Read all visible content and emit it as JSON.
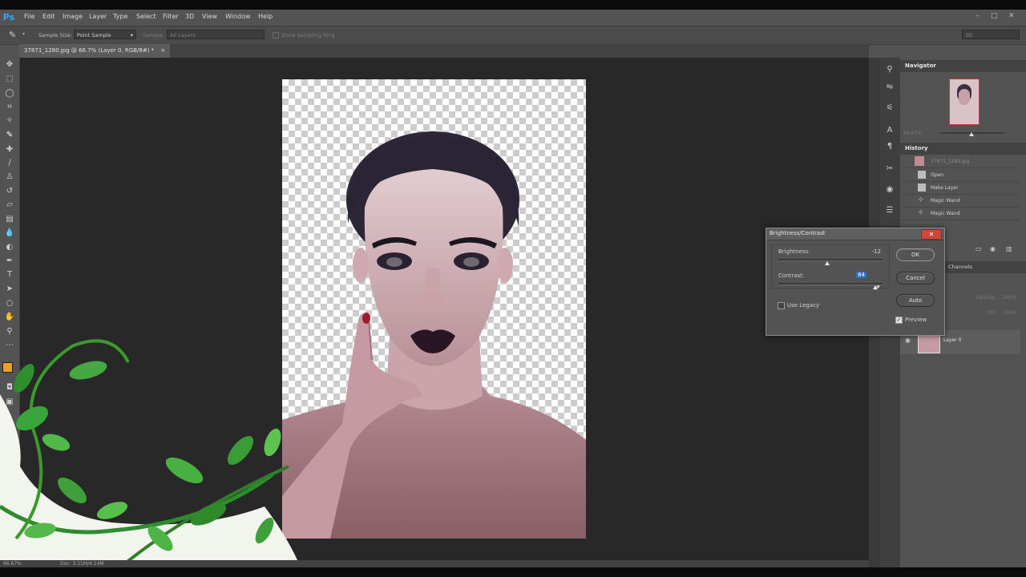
{
  "app": {
    "logo": "Ps",
    "menu": [
      "File",
      "Edit",
      "Image",
      "Layer",
      "Type",
      "Select",
      "Filter",
      "3D",
      "View",
      "Window",
      "Help"
    ],
    "window_controls": [
      "–",
      "□",
      "✕"
    ]
  },
  "options_bar": {
    "sample_size_label": "Sample Size:",
    "sample_size_value": "Point Sample",
    "sample_label": "Sample:",
    "sample_value": "All Layers",
    "show_sampling_ring": "Show Sampling Ring",
    "workspace": "3D"
  },
  "document_tab": {
    "title": "37871_1280.jpg @ 66.7% (Layer 0, RGB/8#) *",
    "close": "×"
  },
  "status_bar": {
    "zoom": "66.67%",
    "doc": "Doc: 3.11M/4.14M"
  },
  "panels": {
    "navigator": {
      "title": "Navigator",
      "zoom": "66.67%"
    },
    "history": {
      "title": "History",
      "snapshot": "37871_1280.jpg",
      "items": [
        "Open",
        "Make Layer",
        "Magic Wand",
        "Magic Wand"
      ]
    },
    "layers": {
      "tab_channels": "Channels",
      "opacity_label": "Opacity:",
      "opacity_value": "100%",
      "fill_label": "Fill:",
      "fill_value": "100%",
      "layer_name": "Layer 0"
    }
  },
  "dialog": {
    "title": "Brightness/Contrast",
    "close": "✕",
    "brightness_label": "Brightness:",
    "brightness_value": "-12",
    "contrast_label": "Contrast:",
    "contrast_value": "84",
    "use_legacy": "Use Legacy",
    "use_legacy_checked": false,
    "preview": "Preview",
    "preview_checked": true,
    "ok": "OK",
    "cancel": "Cancel",
    "auto": "Auto"
  },
  "colors": {
    "foreground": "#f0a020",
    "background": "#ffffff",
    "accent": "#31a8ff"
  }
}
